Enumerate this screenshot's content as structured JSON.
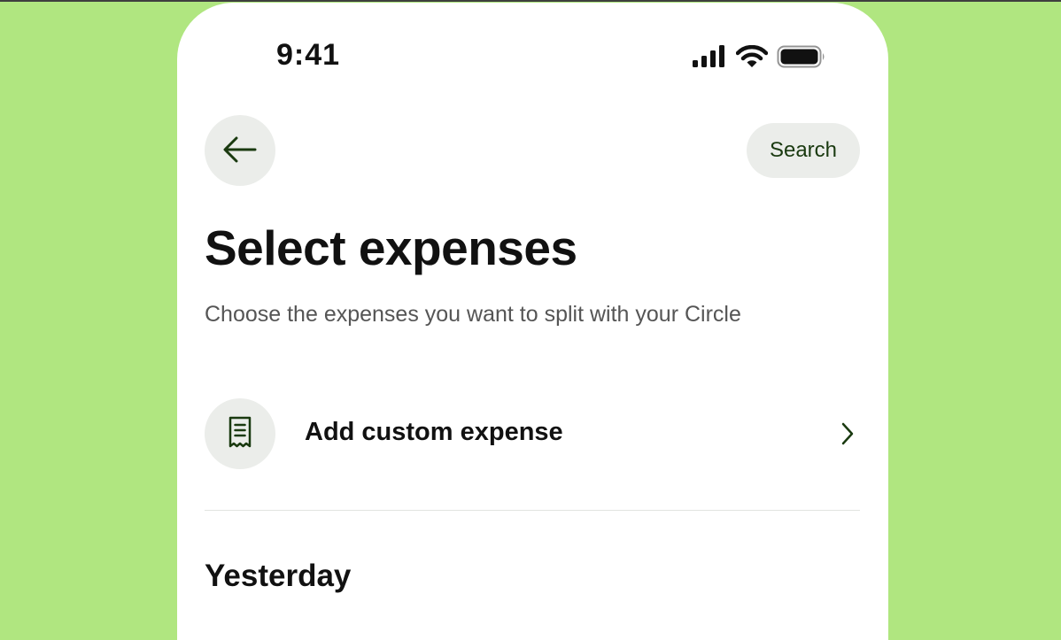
{
  "status_bar": {
    "time": "9:41",
    "icons": [
      "cellular-signal-icon",
      "wifi-icon",
      "battery-icon"
    ]
  },
  "header": {
    "back_icon": "arrow-left-icon",
    "search_label": "Search"
  },
  "page": {
    "title": "Select expenses",
    "subtitle": "Choose the expenses you want to split with your Circle"
  },
  "custom_expense": {
    "icon": "receipt-icon",
    "label": "Add custom expense",
    "chevron_icon": "chevron-right-icon"
  },
  "sections": [
    {
      "title": "Yesterday"
    }
  ],
  "colors": {
    "background": "#b0e680",
    "card": "#ffffff",
    "button_bg": "#ebedea",
    "accent_dark_green": "#1a3a10",
    "text_primary": "#111111",
    "text_secondary": "#555555"
  }
}
